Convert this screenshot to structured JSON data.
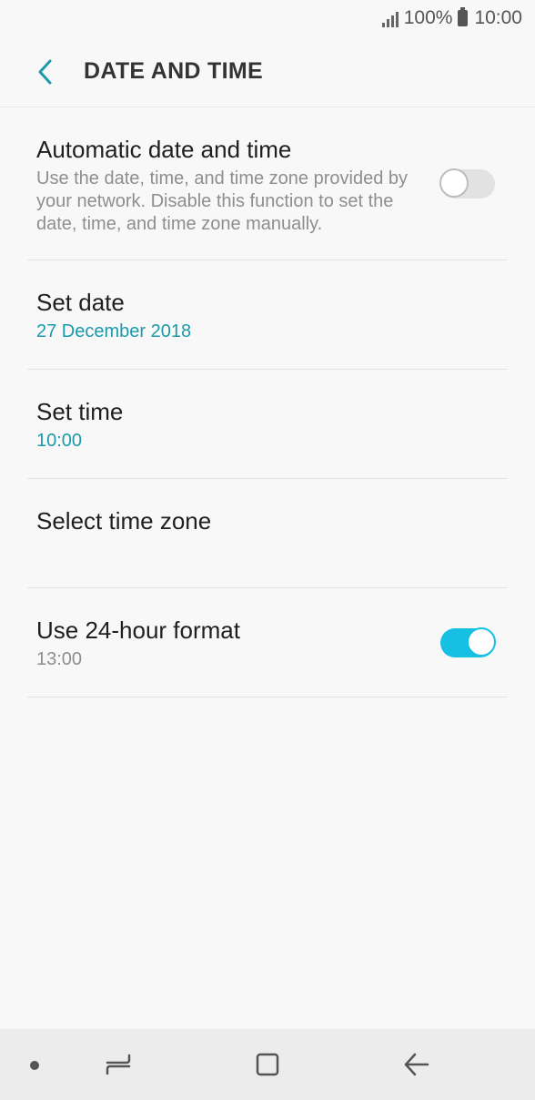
{
  "status_bar": {
    "battery_percent": "100%",
    "time": "10:00"
  },
  "header": {
    "title": "DATE AND TIME",
    "back_icon": "chevron-left-icon",
    "accent_color": "#1b9aaa"
  },
  "settings": {
    "automatic": {
      "title": "Automatic date and time",
      "subtitle": "Use the date, time, and time zone provided by your network. Disable this function to set the date, time, and time zone manually.",
      "toggle_on": false
    },
    "set_date": {
      "title": "Set date",
      "value": "27 December 2018"
    },
    "set_time": {
      "title": "Set time",
      "value": "10:00"
    },
    "time_zone": {
      "title": "Select time zone"
    },
    "format_24": {
      "title": "Use 24-hour format",
      "value": "13:00",
      "toggle_on": true
    }
  },
  "nav_bar": {
    "items": [
      "dot-icon",
      "recents-icon",
      "home-icon",
      "back-arrow-icon"
    ]
  }
}
